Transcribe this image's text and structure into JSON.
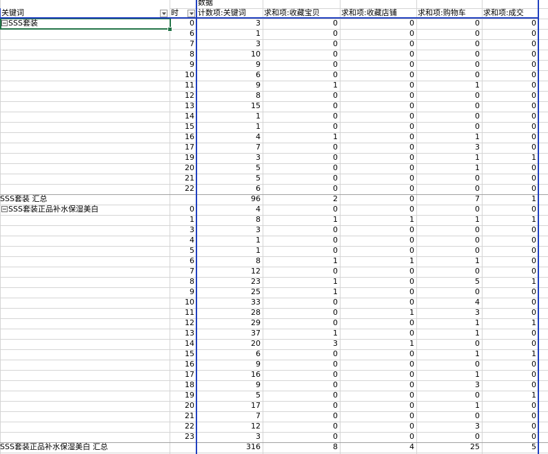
{
  "header": {
    "data_label": "数据",
    "col_keyword": "关键词",
    "col_hour": "时",
    "measures": [
      "计数项:关键词",
      "求和项:收藏宝贝",
      "求和项:收藏店铺",
      "求和项:购物车",
      "求和项:成交"
    ]
  },
  "groups": [
    {
      "name": "SSS套装",
      "subtotal_label": "SSS套装 汇总",
      "rows": [
        [
          "0",
          "3",
          "0",
          "0",
          "0",
          "0"
        ],
        [
          "6",
          "1",
          "0",
          "0",
          "0",
          "0"
        ],
        [
          "7",
          "3",
          "0",
          "0",
          "0",
          "0"
        ],
        [
          "8",
          "10",
          "0",
          "0",
          "0",
          "0"
        ],
        [
          "9",
          "9",
          "0",
          "0",
          "0",
          "0"
        ],
        [
          "10",
          "6",
          "0",
          "0",
          "0",
          "0"
        ],
        [
          "11",
          "9",
          "1",
          "0",
          "1",
          "0"
        ],
        [
          "12",
          "8",
          "0",
          "0",
          "0",
          "0"
        ],
        [
          "13",
          "15",
          "0",
          "0",
          "0",
          "0"
        ],
        [
          "14",
          "1",
          "0",
          "0",
          "0",
          "0"
        ],
        [
          "15",
          "1",
          "0",
          "0",
          "0",
          "0"
        ],
        [
          "16",
          "4",
          "1",
          "0",
          "1",
          "0"
        ],
        [
          "17",
          "7",
          "0",
          "0",
          "3",
          "0"
        ],
        [
          "19",
          "3",
          "0",
          "0",
          "1",
          "1"
        ],
        [
          "20",
          "5",
          "0",
          "0",
          "1",
          "0"
        ],
        [
          "21",
          "5",
          "0",
          "0",
          "0",
          "0"
        ],
        [
          "22",
          "6",
          "0",
          "0",
          "0",
          "0"
        ]
      ],
      "subtotal": [
        "96",
        "2",
        "0",
        "7",
        "1"
      ]
    },
    {
      "name": "SSS套装正品补水保湿美白",
      "subtotal_label": "SSS套装正品补水保湿美白 汇总",
      "rows": [
        [
          "0",
          "4",
          "0",
          "0",
          "0",
          "0"
        ],
        [
          "1",
          "8",
          "1",
          "1",
          "1",
          "1"
        ],
        [
          "3",
          "3",
          "0",
          "0",
          "0",
          "0"
        ],
        [
          "4",
          "1",
          "0",
          "0",
          "0",
          "0"
        ],
        [
          "5",
          "1",
          "0",
          "0",
          "0",
          "0"
        ],
        [
          "6",
          "8",
          "1",
          "1",
          "1",
          "0"
        ],
        [
          "7",
          "12",
          "0",
          "0",
          "0",
          "0"
        ],
        [
          "8",
          "23",
          "1",
          "0",
          "5",
          "1"
        ],
        [
          "9",
          "25",
          "1",
          "0",
          "0",
          "0"
        ],
        [
          "10",
          "33",
          "0",
          "0",
          "4",
          "0"
        ],
        [
          "11",
          "28",
          "0",
          "1",
          "3",
          "0"
        ],
        [
          "12",
          "29",
          "0",
          "0",
          "1",
          "1"
        ],
        [
          "13",
          "37",
          "1",
          "0",
          "1",
          "0"
        ],
        [
          "14",
          "20",
          "3",
          "1",
          "0",
          "0"
        ],
        [
          "15",
          "6",
          "0",
          "0",
          "1",
          "1"
        ],
        [
          "16",
          "9",
          "0",
          "0",
          "0",
          "0"
        ],
        [
          "17",
          "16",
          "0",
          "0",
          "1",
          "0"
        ],
        [
          "18",
          "9",
          "0",
          "0",
          "3",
          "0"
        ],
        [
          "19",
          "5",
          "0",
          "0",
          "0",
          "1"
        ],
        [
          "20",
          "17",
          "0",
          "0",
          "1",
          "0"
        ],
        [
          "21",
          "7",
          "0",
          "0",
          "0",
          "0"
        ],
        [
          "22",
          "12",
          "0",
          "0",
          "3",
          "0"
        ],
        [
          "23",
          "3",
          "0",
          "0",
          "0",
          "0"
        ]
      ],
      "subtotal": [
        "316",
        "8",
        "4",
        "25",
        "5"
      ]
    }
  ],
  "colors": {
    "pivot_border": "#1f3fbf",
    "selection": "#217346",
    "gridline": "#d4d4d4"
  },
  "icons": {
    "filter_dropdown": "dropdown-arrow-icon",
    "collapse": "minus-box-icon"
  }
}
